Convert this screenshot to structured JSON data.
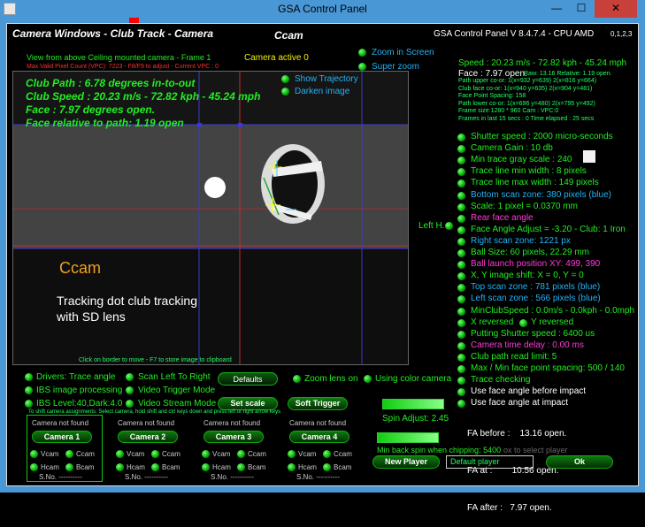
{
  "window": {
    "title": "GSA Control Panel",
    "minimize_glyph": "—",
    "maximize_glyph": "☐",
    "close_glyph": "✕"
  },
  "camera_panel": {
    "title": "Camera Windows - Club Track - Camera",
    "cam_label": "Ccam",
    "view_desc": "View from above Ceiling mounted camera - Frame 1",
    "vpc_line": "Max Valid Pixel Count (VPC): 7223 - F8/F9 to adjust - Current VPC : 0",
    "camera_active": "Camera active 0",
    "click_hint": "Click on border to move - F7 to store image to clipboard",
    "overlay": {
      "club_path": "Club Path : 6.78 degrees in-to-out",
      "club_speed": "Club Speed : 20.23 m/s - 72.82 kph - 45.24 mph",
      "face": "Face : 7.97 degrees open.",
      "face_rel": "Face relative to path: 1.19 open",
      "ccam_big": "Ccam",
      "tracking_text_1": "Tracking dot club tracking",
      "tracking_text_2": "with SD lens"
    },
    "show_trajectory": "Show Trajectory",
    "darken_image": "Darken image"
  },
  "top_right": {
    "version": "GSA Control Panel V 8.4.7.4 - CPU AMD",
    "cams": "0,1,2,3",
    "zoom_in_screen": "Zoom in Screen",
    "super_zoom": "Super zoom",
    "speed_line": "Speed : 20.23 m/s - 72.82 kph - 45.24 mph",
    "face_line": "Face : 7.97 open.",
    "raw_line": "Raw: 13.16 Relative: 1.19 open.",
    "info_lines": [
      "Path upper co-or: 1(x=932 y=639) 2(x=816 y=664)",
      "Club face co-or: 1(x=940 y=635) 2(x=904 y=481)",
      "Face Point Spacing: 158",
      "Path lower co-or: 1(x=696 y=480) 2(x=795 y=492)",
      "Frame size:1280 * 960 Cam : VPC:0",
      "Frames in last 15 secs : 0 Time elapsed : 25 secs"
    ]
  },
  "settings": [
    {
      "text": "Shutter speed : 2000 micro-seconds",
      "color": "#22ee22"
    },
    {
      "text": "Camera Gain : 10 db",
      "color": "#22ee22"
    },
    {
      "text": "Min trace gray scale : 240",
      "color": "#22ee22"
    },
    {
      "text": "Trace line min width : 8 pixels",
      "color": "#22ee22"
    },
    {
      "text": "Trace line max width : 149 pixels",
      "color": "#22ee22"
    },
    {
      "text": "Bottom scan zone: 380 pixels (blue)",
      "color": "#23b2f5"
    },
    {
      "text": "Scale: 1 pixel = 0.0370 mm",
      "color": "#22ee22"
    },
    {
      "text": "Rear face angle",
      "color": "#ff3bd7"
    },
    {
      "text": "Face Angle Adjust = -3.20 - Club: 1 Iron",
      "color": "#22ee22"
    },
    {
      "text": "Right scan zone: 1221 px",
      "color": "#23b2f5"
    },
    {
      "text": "Ball Size: 60 pixels, 22.29 mm",
      "color": "#22ee22"
    },
    {
      "text": "Ball launch position XY: 499, 390",
      "color": "#ff3bd7"
    },
    {
      "text": "X, Y image shift: X = 0,  Y = 0",
      "color": "#22ee22"
    },
    {
      "text": "Top scan zone : 781 pixels (blue)",
      "color": "#23b2f5"
    },
    {
      "text": "Left scan zone : 566 pixels (blue)",
      "color": "#23b2f5"
    },
    {
      "text": "MinClubSpeed : 0.0m/s - 0.0kph - 0.0mph",
      "color": "#22ee22"
    },
    {
      "text": "X reversed",
      "color": "#22ee22",
      "extra": "Y reversed"
    },
    {
      "text": "Putting Shutter speed : 6400 us",
      "color": "#22ee22"
    },
    {
      "text": "Camera time delay : 0.00 ms",
      "color": "#ff3bd7"
    },
    {
      "text": "Club path read limit: 5",
      "color": "#22ee22"
    },
    {
      "text": "Max / Min face point spacing: 500 / 140",
      "color": "#22ee22"
    },
    {
      "text": "Trace checking",
      "color": "#22ee22"
    },
    {
      "text": "Use face angle before impact",
      "color": "#ffffff"
    },
    {
      "text": "Use face angle at impact",
      "color": "#ffffff"
    }
  ],
  "left_h": "Left H.",
  "fa_results": {
    "before": "FA before :    13.16 open.",
    "at": "FA at :        10.56 open.",
    "after": "FA after :   7.97 open."
  },
  "bottom": {
    "drivers_trace": "Drivers: Trace angle",
    "scan_left_right": "Scan Left To Right",
    "defaults": "Defaults",
    "zoom_lens_on": "Zoom lens on",
    "using_color_camera": "Using color camera",
    "ibs_image_processing": "IBS image processing",
    "video_trigger_mode": "Video Trigger Mode",
    "ibs_level": "IBS Level:40,Dark:4.0",
    "video_stream_mode": "Video Stream Mode",
    "set_scale": "Set scale",
    "soft_trigger": "Soft Trigger",
    "shift_hint": "To shift camera assignments: Select camera, hold shift and ctrl keys down and press left or right arrow keys",
    "spin_adjust": "Spin Adjust: 2.45",
    "min_back_spin": "Min back spin when chipping: 5400",
    "select_player_hint": "ox to select player",
    "new_player": "New Player",
    "player_name": "Default player",
    "ok": "Ok"
  },
  "cameras": [
    {
      "status": "Camera not found",
      "button": "Camera 1",
      "vcam": "Vcam",
      "ccam": "Ccam",
      "hcam": "Hcam",
      "bcam": "Bcam",
      "sno": "S.No. ----------"
    },
    {
      "status": "Camera not found",
      "button": "Camera 2",
      "vcam": "Vcam",
      "ccam": "Ccam",
      "hcam": "Hcam",
      "bcam": "Bcam",
      "sno": "S.No. ----------"
    },
    {
      "status": "Camera not found",
      "button": "Camera 3",
      "vcam": "Vcam",
      "ccam": "Ccam",
      "hcam": "Hcam",
      "bcam": "Bcam",
      "sno": "S.No. ----------"
    },
    {
      "status": "Camera not found",
      "button": "Camera 4",
      "vcam": "Vcam",
      "ccam": "Ccam",
      "hcam": "Hcam",
      "bcam": "Bcam",
      "sno": "S.No. ----------"
    }
  ]
}
